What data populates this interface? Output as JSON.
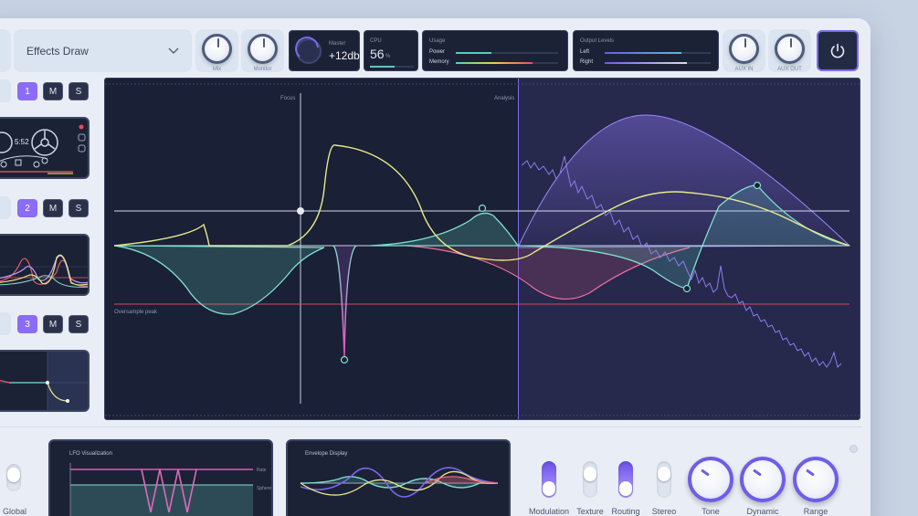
{
  "header": {
    "preset_name": "Effects Draw",
    "knobs": [
      {
        "label": "Mix"
      },
      {
        "label": "Monitor"
      }
    ],
    "master": {
      "label": "Master",
      "value": "+12db"
    },
    "cpu": {
      "label": "CPU",
      "value": "56",
      "unit": "%"
    },
    "usage": {
      "label": "Usage",
      "power_label": "Power",
      "memory_label": "Memory",
      "power_level": 0.35,
      "memory_level": 0.75
    },
    "output": {
      "label": "Output Levels",
      "left_label": "Left",
      "right_label": "Right",
      "left_level": 0.72,
      "right_level": 0.78
    },
    "aux_knobs": [
      {
        "label": "AUX IN"
      },
      {
        "label": "AUX OUT"
      }
    ]
  },
  "tracks": [
    {
      "number": "1",
      "mute": "M",
      "solo": "S",
      "time": "5:52"
    },
    {
      "number": "2",
      "mute": "M",
      "solo": "S"
    },
    {
      "number": "3",
      "mute": "M",
      "solo": "S"
    }
  ],
  "display": {
    "focus_label": "Focus",
    "analysis_label": "Analysis",
    "oversample_label": "Oversample peak"
  },
  "bottom": {
    "global_label": "Global",
    "lfo_label": "LFO Visualization",
    "envelope_label": "Envelope Display",
    "lfo_side_labels": [
      "Rate",
      "Sphere"
    ],
    "toggles": [
      {
        "label": "Modulation",
        "on": true
      },
      {
        "label": "Texture",
        "on": false
      },
      {
        "label": "Routing",
        "on": true
      },
      {
        "label": "Stereo",
        "on": false
      }
    ],
    "knobs": [
      {
        "label": "Tone"
      },
      {
        "label": "Dynamic"
      },
      {
        "label": "Range"
      }
    ]
  },
  "colors": {
    "accent": "#8b6cf6",
    "teal": "#7fe0d0",
    "yellow": "#e7e98a",
    "pink": "#ef6fa0",
    "red_line": "#d8485f"
  }
}
